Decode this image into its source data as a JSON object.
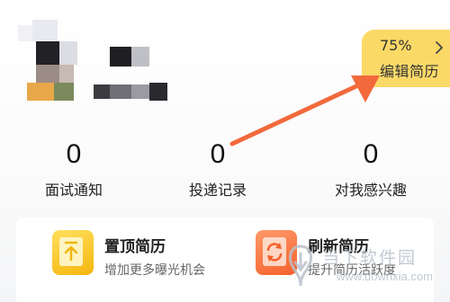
{
  "resume": {
    "completion": "75%",
    "edit_label": "编辑简历"
  },
  "stats": [
    {
      "count": "0",
      "label": "面试通知"
    },
    {
      "count": "0",
      "label": "投递记录"
    },
    {
      "count": "0",
      "label": "对我感兴趣"
    }
  ],
  "services": [
    {
      "title": "置顶简历",
      "subtitle": "增加更多曝光机会",
      "icon": "pin-to-top-icon",
      "color": "#f7be1f"
    },
    {
      "title": "刷新简历",
      "subtitle": "提升简历活跃度",
      "icon": "refresh-icon",
      "color": "#f67341"
    }
  ],
  "watermark": {
    "text": "当下软件园",
    "url": "www.downxia.com"
  },
  "colors": {
    "badge": "#fbd967",
    "arrow": "#f26a3c",
    "pin_icon": "#f7be1f",
    "refresh_icon": "#f67341"
  }
}
